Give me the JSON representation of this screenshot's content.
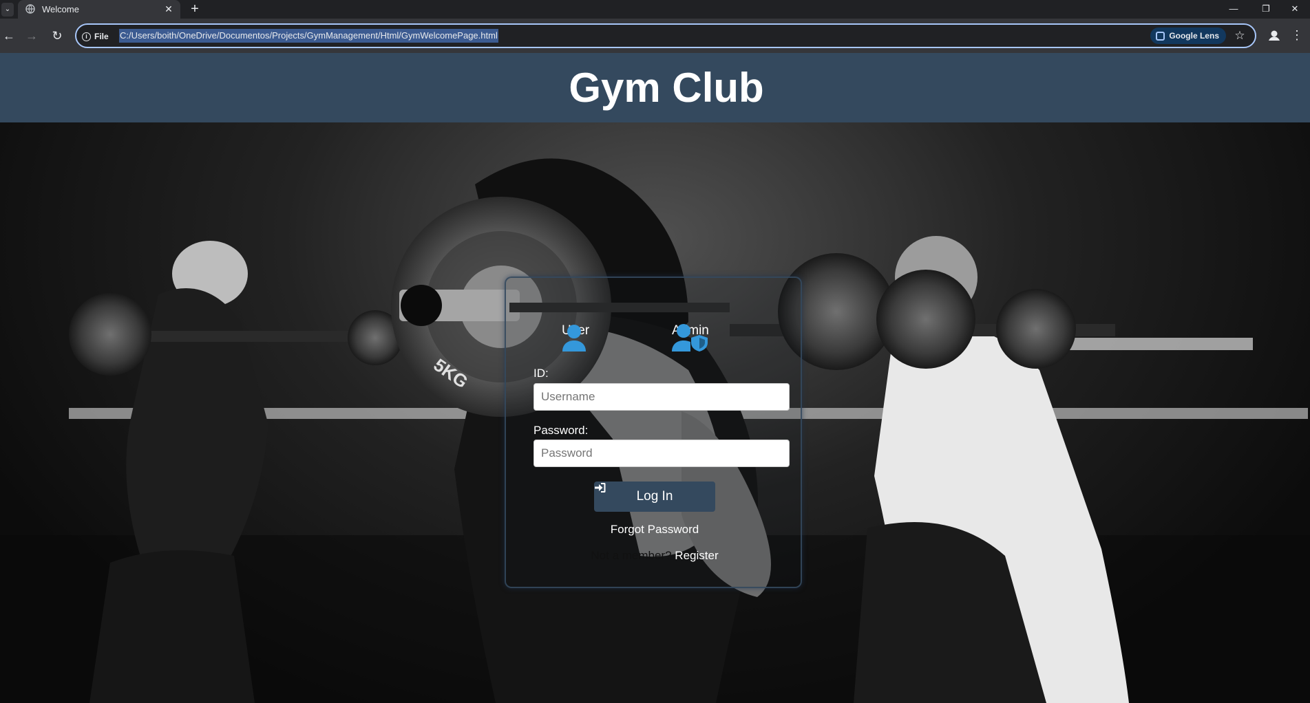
{
  "browser": {
    "tab_title": "Welcome",
    "site_info_label": "File",
    "url": "C:/Users/boith/OneDrive/Documentos/Projects/GymManagement/Html/GymWelcomePage.html",
    "lens_label": "Google Lens",
    "icons": [
      "tab-search-icon",
      "globe-icon",
      "close-icon",
      "plus-icon",
      "minimize-icon",
      "restore-icon",
      "window-close-icon",
      "back-icon",
      "forward-icon",
      "reload-icon",
      "info-icon",
      "google-lens-icon",
      "star-icon",
      "profile-icon",
      "more-menu-icon"
    ]
  },
  "header": {
    "title": "Gym Club"
  },
  "login": {
    "roles": [
      {
        "label": "User",
        "icon": "user-icon"
      },
      {
        "label": "Admin",
        "icon": "admin-shield-icon"
      }
    ],
    "id_label": "ID:",
    "username_placeholder": "Username",
    "password_label": "Password:",
    "password_placeholder": "Password",
    "login_button": "Log In",
    "forgot_password": "Forgot Password",
    "not_member_text": "Not a member?",
    "register_link": "Register"
  },
  "colors": {
    "header_bg": "#34495e",
    "icon_blue": "#3498db",
    "button_bg": "#34495e"
  }
}
